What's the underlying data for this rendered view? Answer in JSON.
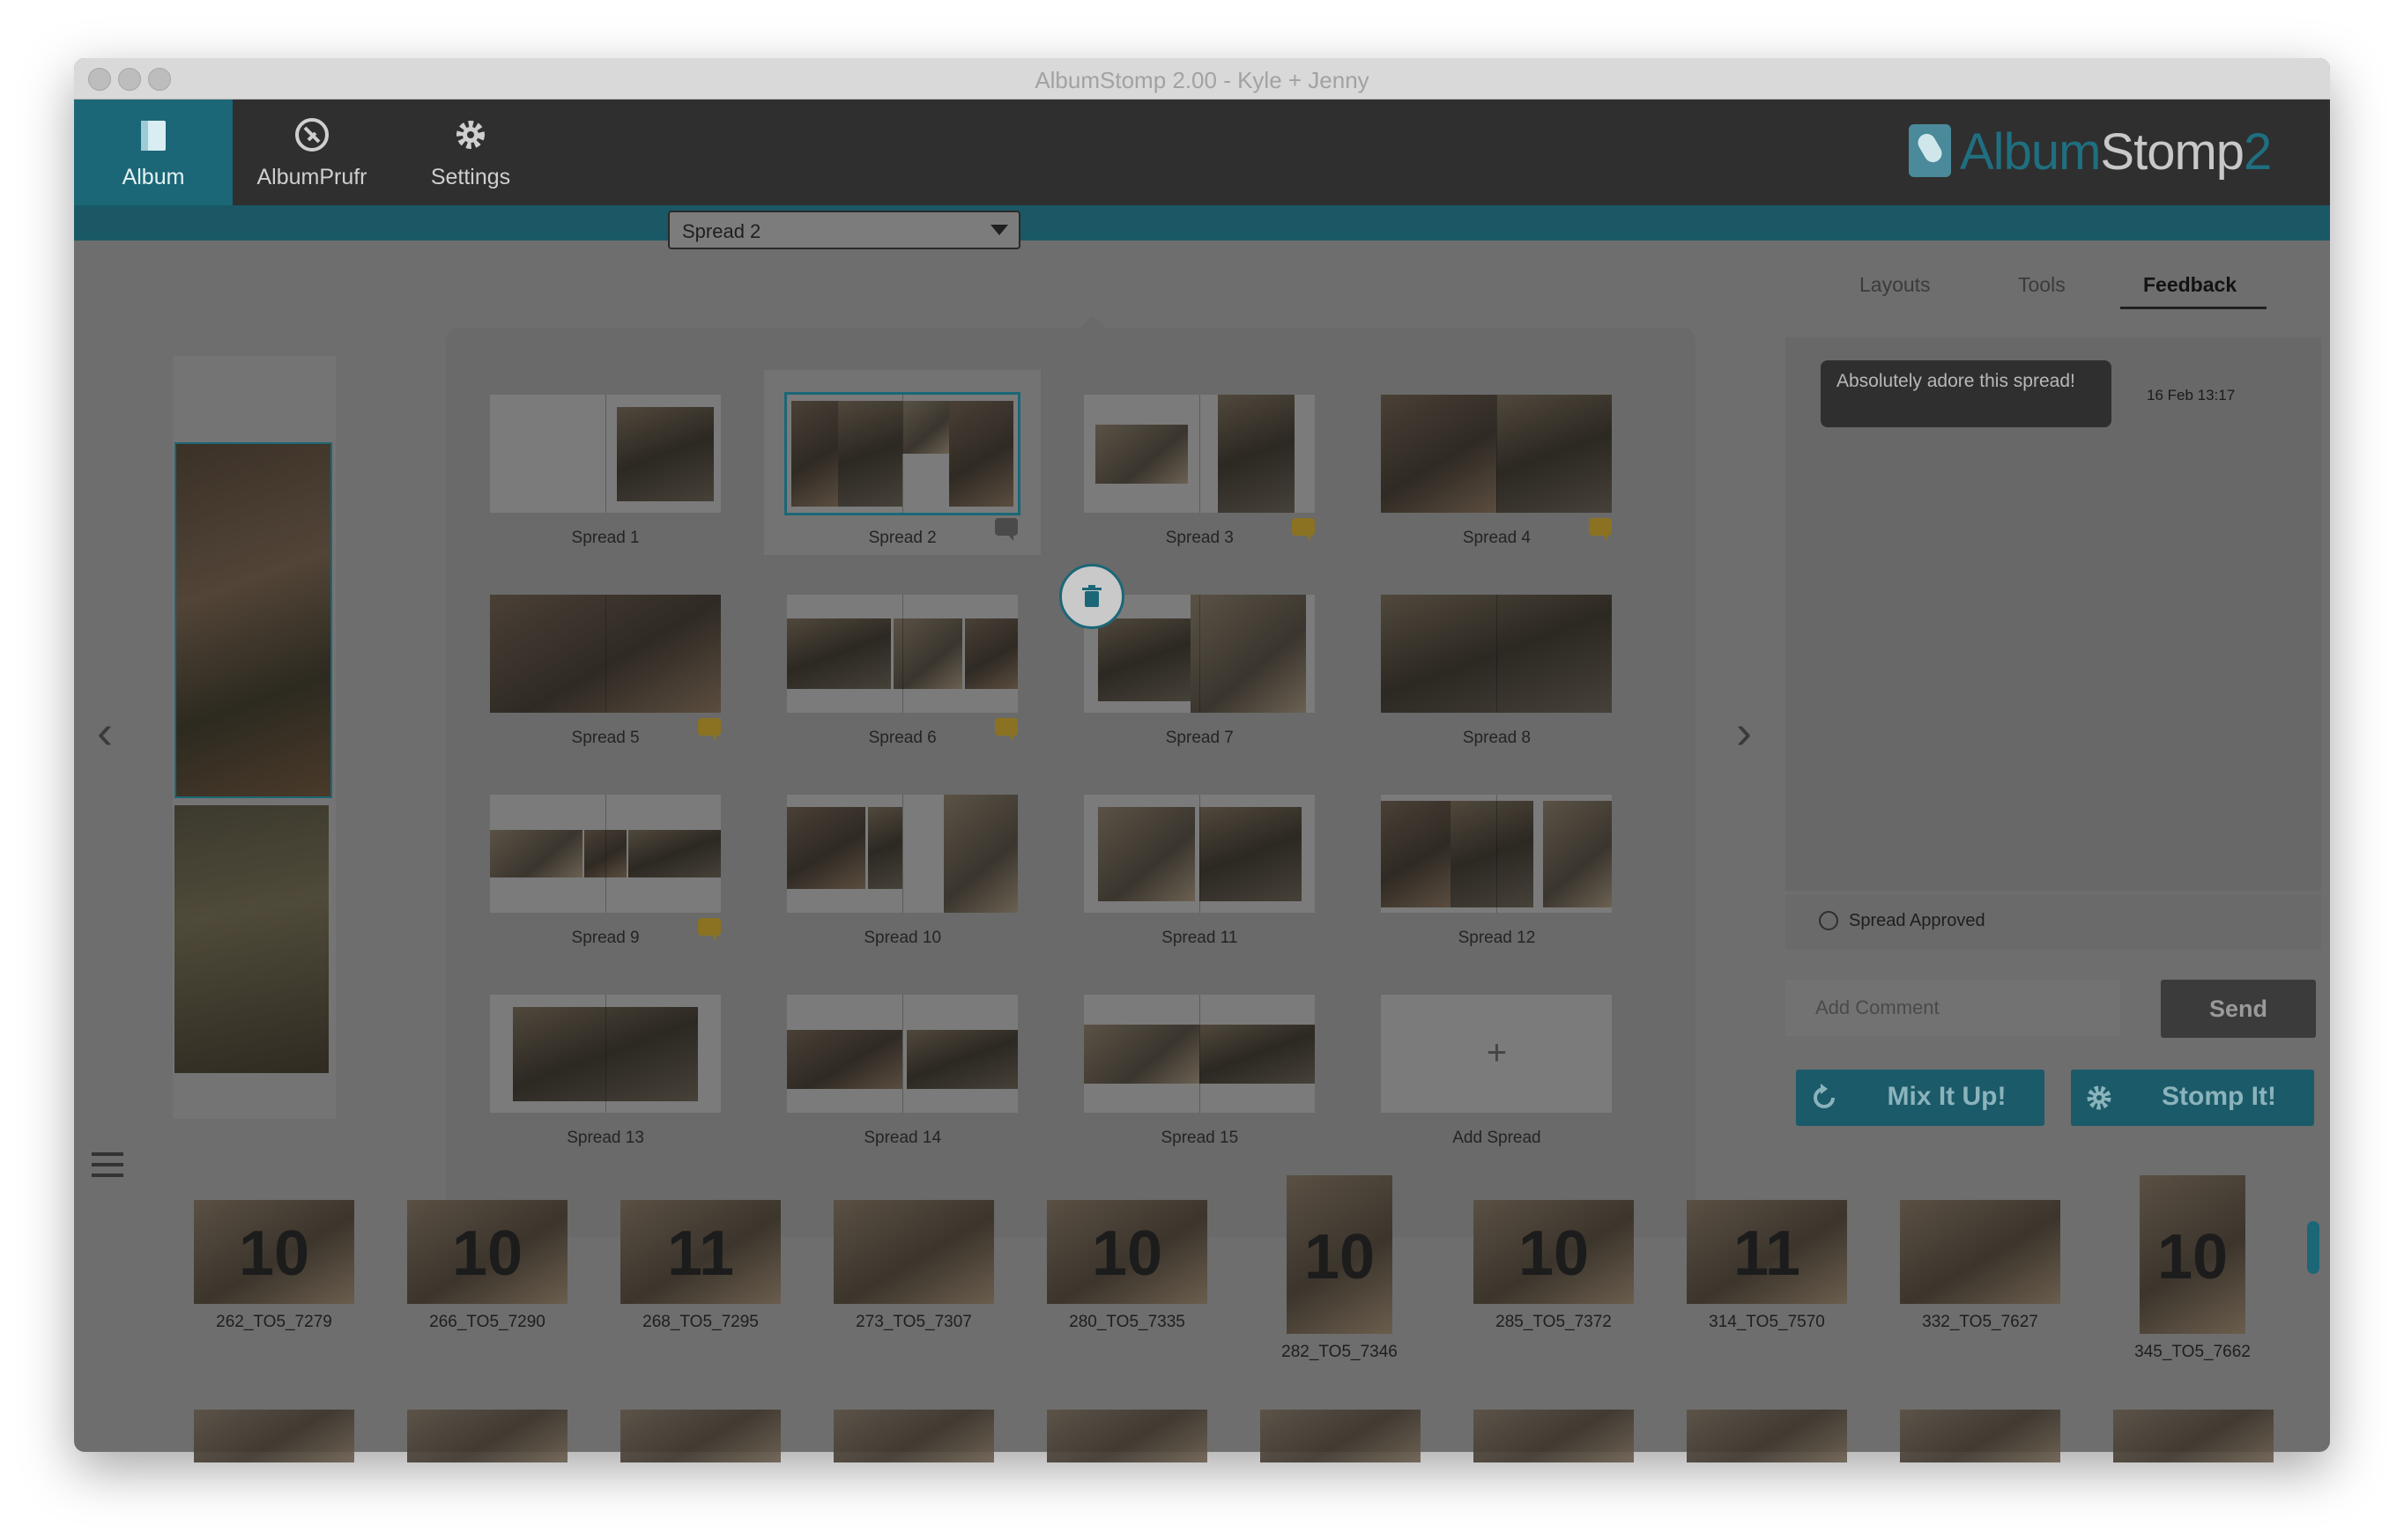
{
  "window": {
    "title": "AlbumStomp 2.00 - Kyle + Jenny"
  },
  "nav": [
    {
      "label": "Album",
      "icon": "album-icon",
      "active": true
    },
    {
      "label": "AlbumPrufr",
      "icon": "albumprufr-icon",
      "active": false
    },
    {
      "label": "Settings",
      "icon": "gear-icon",
      "active": false
    }
  ],
  "logo": {
    "part1": "Album",
    "part2": "Stomp",
    "part3": "2"
  },
  "spread_select": {
    "value": "Spread 2"
  },
  "right_tabs": [
    {
      "label": "Layouts"
    },
    {
      "label": "Tools"
    },
    {
      "label": "Feedback",
      "active": true
    }
  ],
  "feedback": {
    "comment": "Absolutely adore this spread!",
    "timestamp": "16 Feb 13:17",
    "approved_label": "Spread Approved",
    "comment_placeholder": "Add Comment",
    "send_label": "Send"
  },
  "actions": {
    "mix_label": "Mix It Up!",
    "stomp_label": "Stomp It!"
  },
  "spreads": [
    {
      "name": "Spread 1",
      "chat": ""
    },
    {
      "name": "Spread 2",
      "chat": "gray",
      "selected": true
    },
    {
      "name": "Spread 3",
      "chat": "yellow"
    },
    {
      "name": "Spread 4",
      "chat": "yellow"
    },
    {
      "name": "Spread 5",
      "chat": "yellow"
    },
    {
      "name": "Spread 6",
      "chat": "yellow"
    },
    {
      "name": "Spread 7",
      "chat": ""
    },
    {
      "name": "Spread 8",
      "chat": ""
    },
    {
      "name": "Spread 9",
      "chat": "yellow"
    },
    {
      "name": "Spread 10",
      "chat": ""
    },
    {
      "name": "Spread 11",
      "chat": ""
    },
    {
      "name": "Spread 12",
      "chat": ""
    },
    {
      "name": "Spread 13",
      "chat": ""
    },
    {
      "name": "Spread 14",
      "chat": ""
    },
    {
      "name": "Spread 15",
      "chat": ""
    }
  ],
  "add_spread": {
    "label": "Add Spread",
    "plus": "+"
  },
  "strip": [
    {
      "num": "10",
      "cap": "262_TO5_7279"
    },
    {
      "num": "10",
      "cap": "266_TO5_7290"
    },
    {
      "num": "11",
      "cap": "268_TO5_7295"
    },
    {
      "num": "",
      "cap": "273_TO5_7307"
    },
    {
      "num": "10",
      "cap": "280_TO5_7335"
    },
    {
      "num": "10",
      "cap": "282_TO5_7346"
    },
    {
      "num": "10",
      "cap": "285_TO5_7372"
    },
    {
      "num": "11",
      "cap": "314_TO5_7570"
    },
    {
      "num": "",
      "cap": "332_TO5_7627"
    },
    {
      "num": "10",
      "cap": "345_TO5_7662"
    }
  ]
}
